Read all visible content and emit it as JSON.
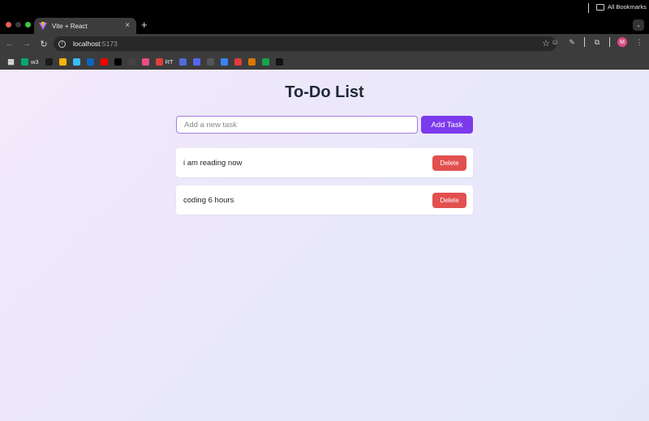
{
  "browser": {
    "tab_title": "Vite + React",
    "url_host": "localhost",
    "url_port": ":5173",
    "bookmarks": [
      {
        "icon": "apps-grid-icon",
        "label": "",
        "color": "#3c3c3c"
      },
      {
        "icon": "w3schools-icon",
        "label": "w3",
        "color": "#04aa6d"
      },
      {
        "icon": "notion-dark-icon",
        "label": "",
        "color": "#1a1a1a"
      },
      {
        "icon": "google-drive-icon",
        "label": "",
        "color": "#f4b400"
      },
      {
        "icon": "tailwind-icon",
        "label": "",
        "color": "#38bdf8"
      },
      {
        "icon": "linkedin-icon",
        "label": "",
        "color": "#0a66c2"
      },
      {
        "icon": "youtube-icon",
        "label": "",
        "color": "#ff0000"
      },
      {
        "icon": "x-icon",
        "label": "",
        "color": "#000000"
      },
      {
        "icon": "github-icon",
        "label": "",
        "color": "#444444"
      },
      {
        "icon": "dribbble-icon",
        "label": "",
        "color": "#ea4c89"
      },
      {
        "icon": "rt-icon",
        "label": "RT",
        "color": "#e0403c"
      },
      {
        "icon": "discord-blue-icon",
        "label": "",
        "color": "#4f6bd9"
      },
      {
        "icon": "discord-icon",
        "label": "",
        "color": "#5865f2"
      },
      {
        "icon": "notion-icon",
        "label": "",
        "color": "#555555"
      },
      {
        "icon": "puzzle-blue-icon",
        "label": "",
        "color": "#3b82f6"
      },
      {
        "icon": "tmdb-icon",
        "label": "",
        "color": "#e03c3c"
      },
      {
        "icon": "sandwich-icon",
        "label": "",
        "color": "#d97706"
      },
      {
        "icon": "cdn-icon",
        "label": "",
        "color": "#16a34a"
      },
      {
        "icon": "r-icon",
        "label": "",
        "color": "#111111"
      }
    ],
    "all_bookmarks": "All Bookmarks"
  },
  "app": {
    "title": "To-Do List",
    "input_placeholder": "Add a new task",
    "add_button": "Add Task",
    "tasks": [
      {
        "text": "i am reading now",
        "delete_label": "Delete"
      },
      {
        "text": "coding 6 hours",
        "delete_label": "Delete"
      }
    ],
    "accent": "#7c3aed",
    "danger": "#e2504f"
  }
}
